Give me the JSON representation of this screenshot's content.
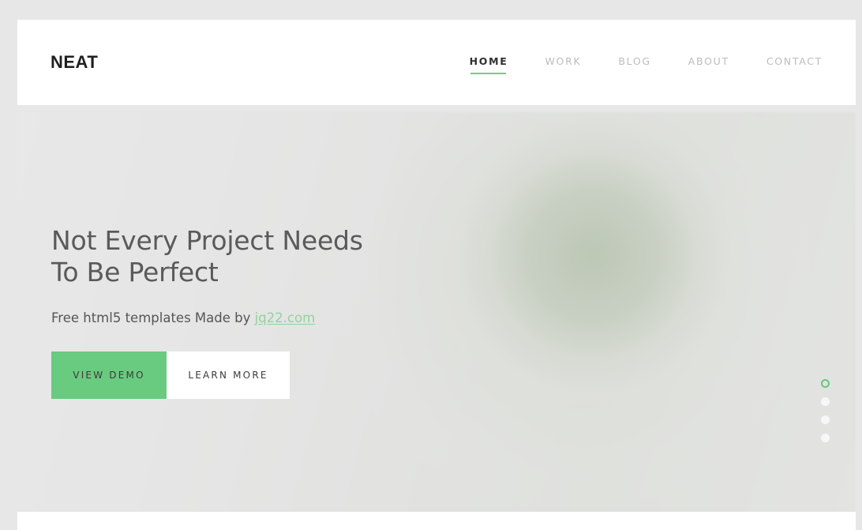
{
  "header": {
    "brand": "NEAT",
    "nav": [
      {
        "label": "HOME",
        "active": true
      },
      {
        "label": "WORK",
        "active": false
      },
      {
        "label": "BLOG",
        "active": false
      },
      {
        "label": "ABOUT",
        "active": false
      },
      {
        "label": "CONTACT",
        "active": false
      }
    ]
  },
  "hero": {
    "title": "Not Every Project Needs To Be Perfect",
    "subtitle_prefix": "Free html5 templates Made by ",
    "subtitle_link": "jq22.com",
    "buttons": {
      "primary": "VIEW DEMO",
      "secondary": "LEARN MORE"
    },
    "slider": {
      "count": 4,
      "active_index": 0
    }
  },
  "colors": {
    "accent_green": "#6ece89",
    "button_green": "#69cb7f",
    "link_green": "#8ed49e",
    "page_background": "#e7e7e7",
    "header_background": "#ffffff",
    "heading_text": "#5a5a5a",
    "nav_inactive": "#bcbcbc",
    "nav_active": "#2f2f2f"
  }
}
